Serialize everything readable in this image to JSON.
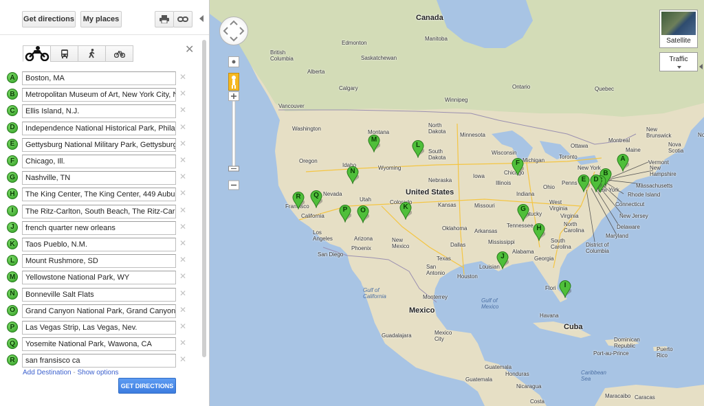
{
  "toolbar": {
    "get_directions": "Get directions",
    "my_places": "My places",
    "print_icon": "printer-icon",
    "link_icon": "link-icon"
  },
  "travel_modes": [
    {
      "name": "driving",
      "icon": "motorcycle-icon",
      "selected": true
    },
    {
      "name": "transit",
      "icon": "bus-icon",
      "selected": false
    },
    {
      "name": "walking",
      "icon": "walking-person-icon",
      "selected": false
    },
    {
      "name": "bicycling",
      "icon": "bicycle-icon",
      "selected": false
    }
  ],
  "destinations": [
    {
      "letter": "A",
      "value": "Boston, MA"
    },
    {
      "letter": "B",
      "value": "Metropolitan Museum of Art, New York City, N"
    },
    {
      "letter": "C",
      "value": "Ellis Island, N.J."
    },
    {
      "letter": "D",
      "value": "Independence National Historical Park, Philade"
    },
    {
      "letter": "E",
      "value": "Gettysburg National Military Park, Gettysburg,"
    },
    {
      "letter": "F",
      "value": "Chicago, Ill."
    },
    {
      "letter": "G",
      "value": "Nashville, TN"
    },
    {
      "letter": "H",
      "value": "The King Center, The King Center, 449 Auburn"
    },
    {
      "letter": "I",
      "value": "The Ritz-Carlton, South Beach, The Ritz-Carlto"
    },
    {
      "letter": "J",
      "value": "french quarter new orleans"
    },
    {
      "letter": "K",
      "value": "Taos Pueblo, N.M."
    },
    {
      "letter": "L",
      "value": "Mount Rushmore, SD"
    },
    {
      "letter": "M",
      "value": "Yellowstone National Park, WY"
    },
    {
      "letter": "N",
      "value": "Bonneville Salt Flats"
    },
    {
      "letter": "O",
      "value": "Grand Canyon National Park, Grand Canyon V"
    },
    {
      "letter": "P",
      "value": "Las Vegas Strip, Las Vegas, Nev."
    },
    {
      "letter": "Q",
      "value": "Yosemite National Park, Wawona, CA"
    },
    {
      "letter": "R",
      "value": "san fransisco ca"
    }
  ],
  "links": {
    "add_destination": "Add Destination",
    "separator": " - ",
    "show_options": "Show options"
  },
  "submit_label": "GET DIRECTIONS",
  "map": {
    "satellite_label": "Satellite",
    "traffic_label": "Traffic",
    "countries": [
      "Canada",
      "United States",
      "Mexico",
      "Cuba"
    ],
    "labels": {
      "canada": "Canada",
      "us": "United States",
      "mexico": "Mexico",
      "cuba": "Cuba",
      "bc": "British\nColumbia",
      "alberta": "Alberta",
      "sask": "Saskatchewan",
      "manitoba": "Manitoba",
      "ontario": "Ontario",
      "quebec": "Quebec",
      "edmonton": "Edmonton",
      "calgary": "Calgary",
      "vancouver": "Vancouver",
      "winnipeg": "Winnipeg",
      "nb": "New\nBrunswick",
      "ns": "Nova\nScotia",
      "ottawa": "Ottawa",
      "montreal": "Montreal",
      "toronto": "Toronto",
      "maine": "Maine",
      "vermont": "Vermont",
      "nh": "New\nHampshire",
      "mass": "Massachusetts",
      "ri": "Rhode Island",
      "ct": "Connecticut",
      "nj": "New Jersey",
      "de": "Delaware",
      "md": "Maryland",
      "dc": "District of\nColumbia",
      "newyork": "New York",
      "newyork2": "New York",
      "penn": "Penns",
      "wv": "West\nVirginia",
      "va": "Virginia",
      "nc": "North\nCarolina",
      "sc": "South\nCarolina",
      "georgia": "Georgia",
      "alabama": "Alabama",
      "florida": "Flori",
      "tennessee": "Tennessee",
      "kentucky": "ntucky",
      "ohio": "Ohio",
      "indiana": "Indiana",
      "illinois": "Illinois",
      "michigan": "Michigan",
      "wisconsin": "Wisconsin",
      "minnesota": "Minnesota",
      "iowa": "Iowa",
      "missouri": "Missouri",
      "arkansas": "Arkansas",
      "mississippi": "Mississippi",
      "louisiana": "Louisian",
      "chicago": "Chicago",
      "nd": "North\nDakota",
      "sd": "South\nDakota",
      "nebraska": "Nebraska",
      "kansas": "Kansas",
      "oklahoma": "Oklahoma",
      "texas": "Texas",
      "dallas": "Dallas",
      "houston": "Houston",
      "sanantonio": "San\nAntonio",
      "montana": "Montana",
      "wyoming": "Wyoming",
      "idaho": "Idaho",
      "washington": "Washington",
      "oregon": "Oregon",
      "nevada": "Nevada",
      "utah": "Utah",
      "colorado": "Colorado",
      "arizona": "Arizona",
      "nm": "New\nMexico",
      "california": "California",
      "francisco": "Francisco",
      "losangeles": "Los\nAngeles",
      "sandiego": "San Diego",
      "phoenix": "Phoenix",
      "gulfcal": "Gulf of\nCalifornia",
      "gulfmex": "Gulf of\nMexico",
      "monterrey": "Monterrey",
      "mexicocity": "Mexico\nCity",
      "guadalajara": "Guadalajara",
      "havana": "Havana",
      "dr": "Dominican\nRepublic",
      "pr": "Puerto\nRico",
      "portauprince": "Port-au-Prince",
      "caribbean": "Caribbean\nSea",
      "guatemala": "Guatemala",
      "guatemala2": "Guatemala",
      "honduras": "Honduras",
      "nicaragua": "Nicaragua",
      "costa": "Costa",
      "maracaibo": "Maracaibo",
      "caracas": "Caracas",
      "nova": "Nova"
    }
  }
}
